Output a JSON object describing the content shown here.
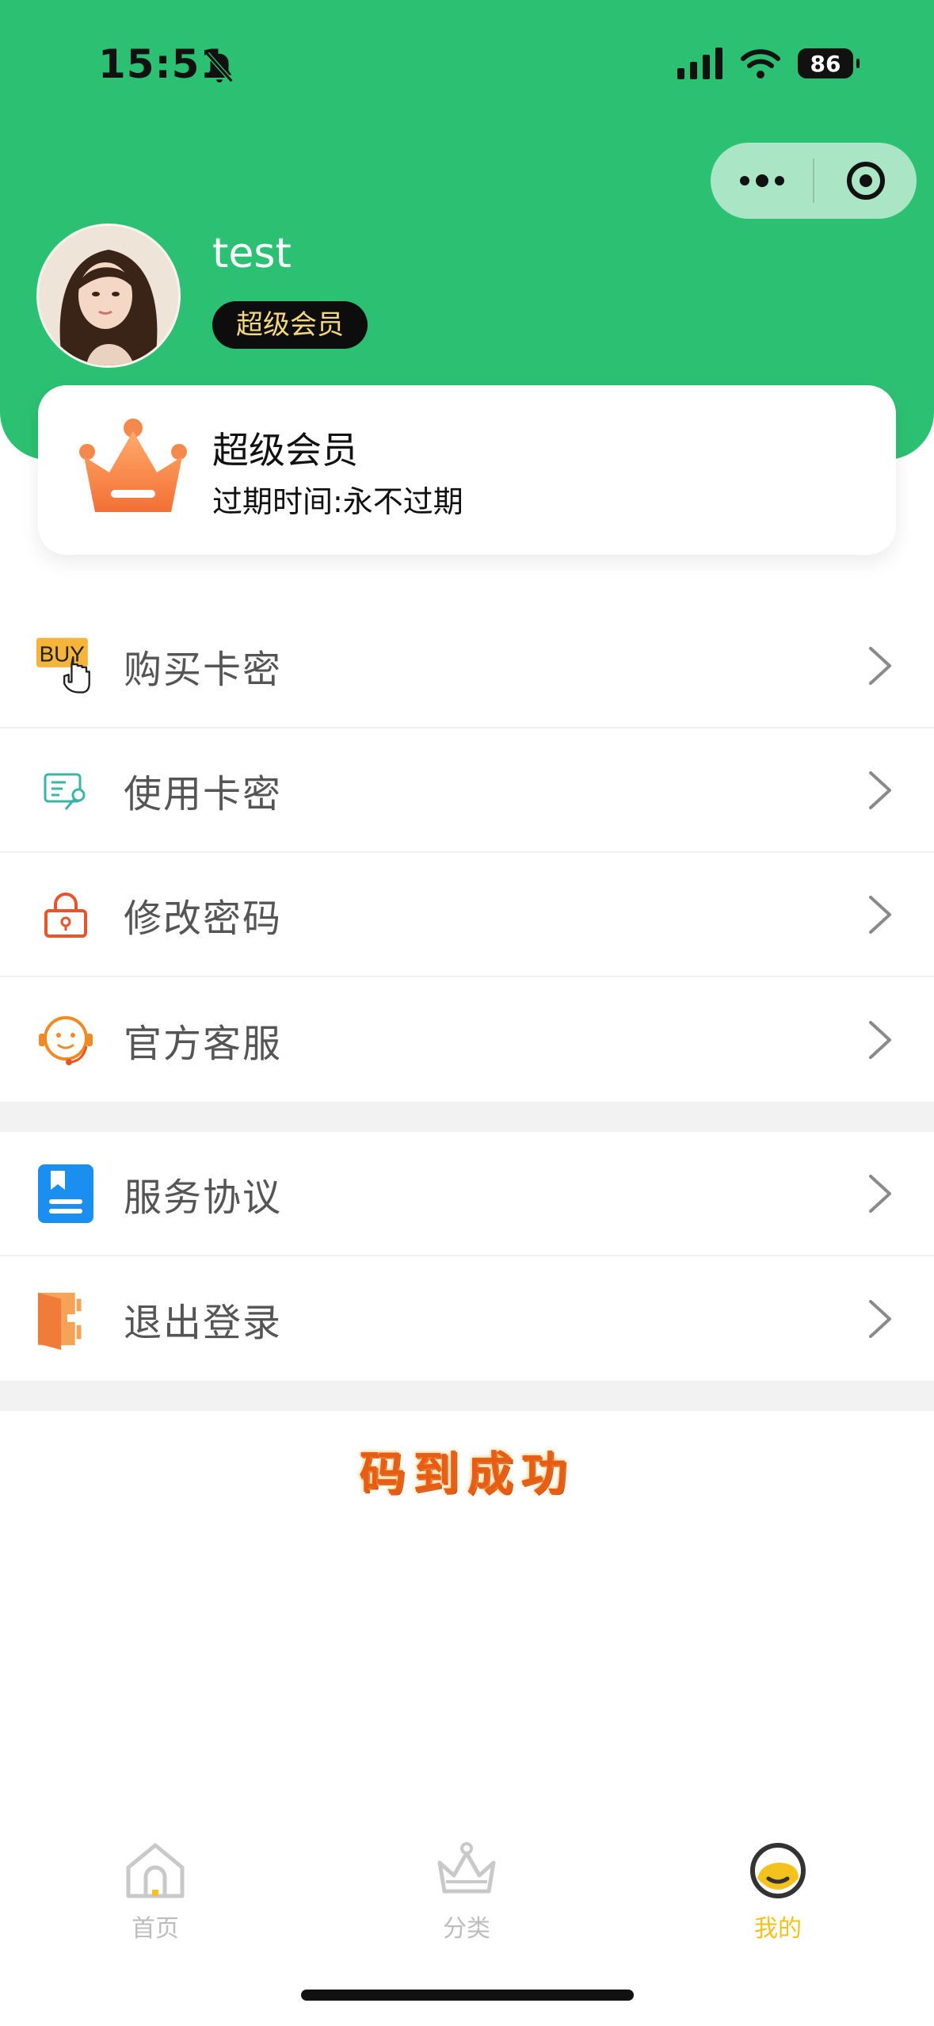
{
  "status_bar": {
    "time": "15:51",
    "battery": "86"
  },
  "profile": {
    "username": "test",
    "vip_badge": "超级会员"
  },
  "member_card": {
    "title": "超级会员",
    "expire": "过期时间:永不过期"
  },
  "menu_group_1": [
    {
      "label": "购买卡密",
      "icon": "buy-icon"
    },
    {
      "label": "使用卡密",
      "icon": "card-key-icon"
    },
    {
      "label": "修改密码",
      "icon": "lock-icon"
    },
    {
      "label": "官方客服",
      "icon": "customer-service-icon"
    }
  ],
  "menu_group_2": [
    {
      "label": "服务协议",
      "icon": "agreement-icon"
    },
    {
      "label": "退出登录",
      "icon": "logout-icon"
    }
  ],
  "banner": {
    "text": "码到成功"
  },
  "buy_icon_text": "BUY",
  "tabbar": [
    {
      "label": "首页",
      "icon": "home-icon"
    },
    {
      "label": "分类",
      "icon": "crown-icon"
    },
    {
      "label": "我的",
      "icon": "smile-icon",
      "active": true
    }
  ],
  "colors": {
    "header": "#2cc172",
    "active_tab": "#f4c21d",
    "badge_text": "#f2d77e"
  }
}
